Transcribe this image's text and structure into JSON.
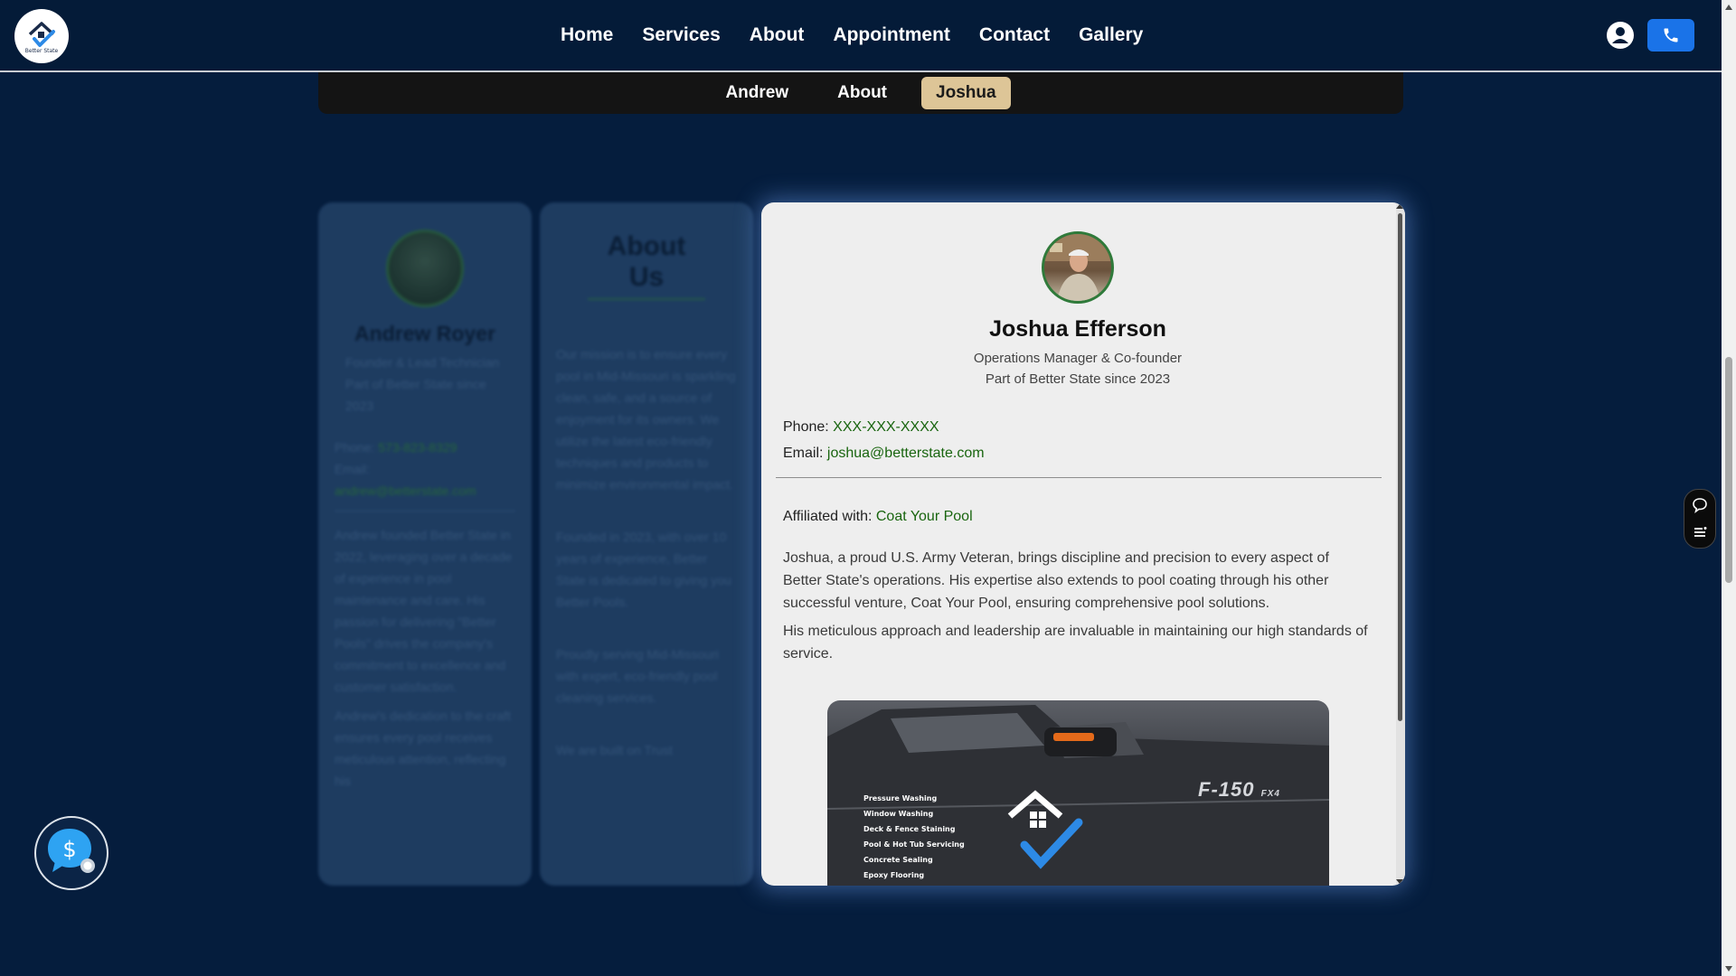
{
  "brand": {
    "logo_text": "Better State"
  },
  "nav": {
    "items": [
      {
        "label": "Home"
      },
      {
        "label": "Services"
      },
      {
        "label": "About"
      },
      {
        "label": "Appointment"
      },
      {
        "label": "Contact"
      },
      {
        "label": "Gallery"
      }
    ]
  },
  "subtabs": {
    "items": [
      {
        "label": "Andrew"
      },
      {
        "label": "About"
      },
      {
        "label": "Joshua"
      }
    ],
    "active": "Joshua"
  },
  "andrew_card": {
    "name": "Andrew Royer",
    "role": "Founder & Lead Technician",
    "since": "Part of Better State since 2023",
    "phone_label": "Phone:",
    "phone": "573-823-8329",
    "email_label": "Email:",
    "email": "andrew@betterstate.com",
    "bio_1": "Andrew founded Better State in 2022, leveraging over a decade of experience in pool maintenance and care. His passion for delivering \"Better Pools\" drives the company's commitment to excellence and customer satisfaction.",
    "bio_2": "Andrew's dedication to the craft ensures every pool receives meticulous attention, reflecting his"
  },
  "about_card": {
    "heading": "About Us",
    "p1": "Our mission is to ensure every pool in Mid-Missouri is sparkling clean, safe, and a source of enjoyment for its owners. We utilize the latest eco-friendly techniques and products to minimize environmental impact.",
    "p2": "Founded in 2023, with over 10 years of experience, Better State is dedicated to giving you Better Pools.",
    "p3": "Proudly serving Mid-Missouri with expert, eco-friendly pool cleaning services.",
    "p4": "We are built on Trust"
  },
  "profile": {
    "name": "Joshua Efferson",
    "role": "Operations Manager & Co-founder",
    "since": "Part of Better State since 2023",
    "phone_label": "Phone:",
    "phone": "XXX-XXX-XXXX",
    "email_label": "Email:",
    "email": "joshua@betterstate.com",
    "affiliated_label": "Affiliated with:",
    "affiliated": "Coat Your Pool",
    "bio_1": "Joshua, a proud U.S. Army Veteran, brings discipline and precision to every aspect of Better State's operations. His expertise also extends to pool coating through his other successful venture, Coat Your Pool, ensuring comprehensive pool solutions.",
    "bio_2": "His meticulous approach and leadership are invaluable in maintaining our high standards of service."
  },
  "truck_photo": {
    "services": [
      "Pressure Washing",
      "Window Washing",
      "Deck & Fence Staining",
      "Pool & Hot Tub Servicing",
      "Concrete Sealing",
      "Epoxy Flooring"
    ],
    "model": "F-150",
    "trim": "FX4"
  },
  "icons": {
    "account": "user-circle-icon",
    "call": "phone-icon",
    "chat": "chat-bubble-icon",
    "menu": "list-icon",
    "pricing": "dollar-chat-icon"
  },
  "colors": {
    "background": "#051d3d",
    "header": "#041b38",
    "active_tab": "#ddc597",
    "link_green": "#19650f",
    "call_button": "#1a73e8"
  }
}
